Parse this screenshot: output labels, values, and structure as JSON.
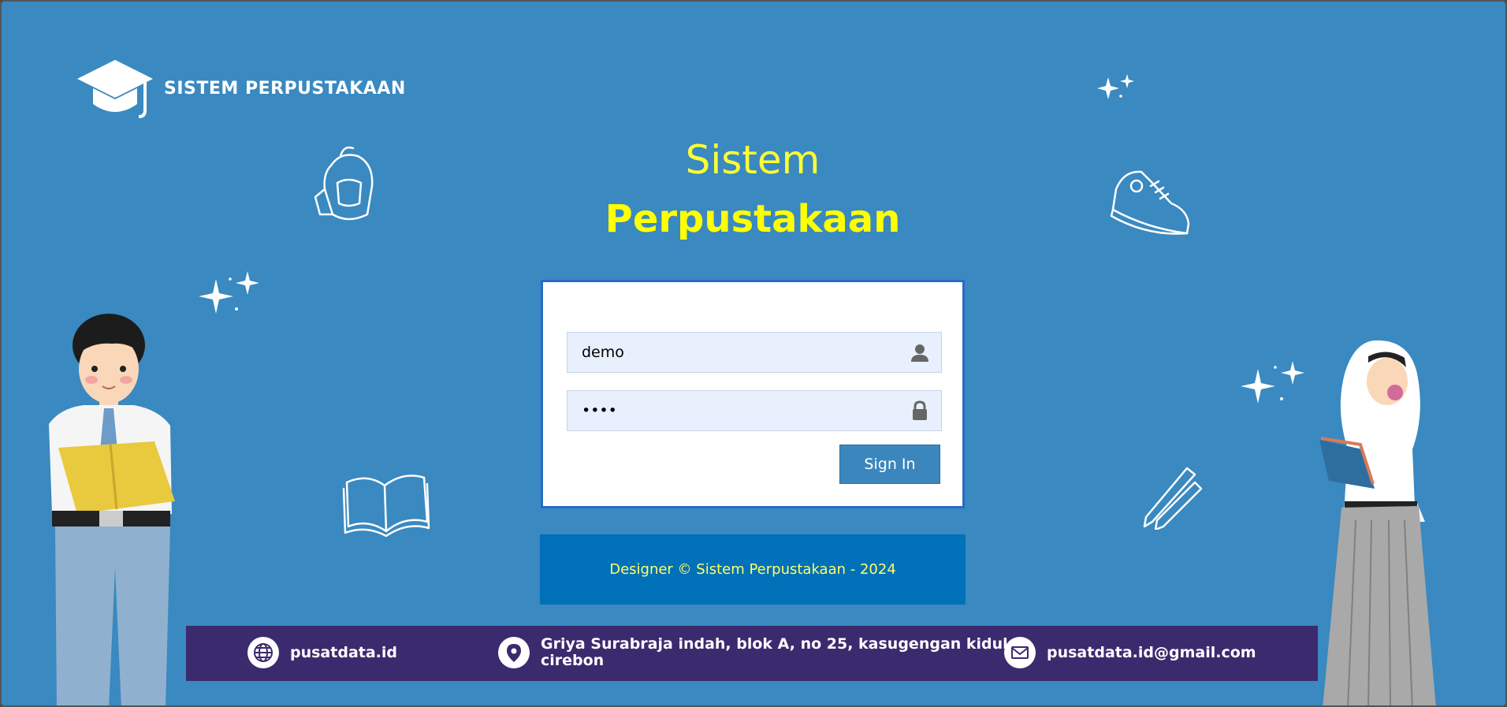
{
  "header": {
    "logo_text": "SISTEM PERPUSTAKAAN"
  },
  "title": {
    "line1": "Sistem",
    "line2": "Perpustakaan"
  },
  "login": {
    "username_value": "demo",
    "password_value": "demo",
    "signin_label": "Sign In"
  },
  "copyright": "Designer © Sistem Perpustakaan - 2024",
  "footer": {
    "website": "pusatdata.id",
    "address_line1": "Griya Surabraja indah, blok A, no 25, kasugengan kidul,",
    "address_line2": "cirebon",
    "email": "pusatdata.id@gmail.com"
  },
  "colors": {
    "background": "#3a89c0",
    "title": "#ffff00",
    "signin_button": "#3b86bd",
    "copyright_bar": "#0070b8",
    "footer_bar": "#3c2a6e"
  },
  "icons": {
    "logo": "graduation-cap-icon",
    "username": "user-icon",
    "password": "lock-icon",
    "website": "globe-icon",
    "address": "map-pin-icon",
    "email": "envelope-icon"
  }
}
